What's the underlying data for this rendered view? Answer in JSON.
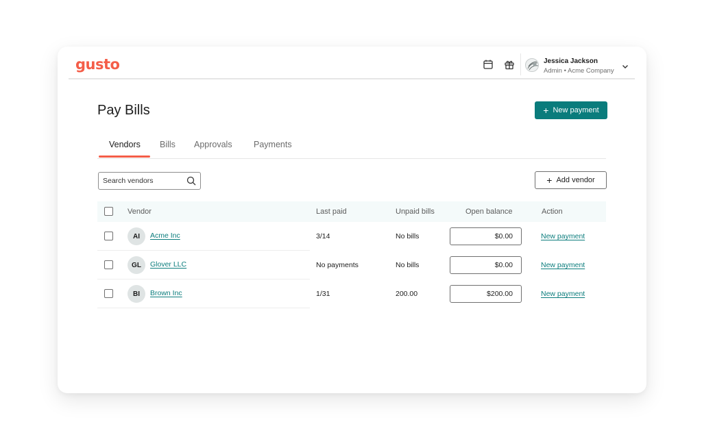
{
  "header": {
    "logo": "gusto",
    "user_name": "Jessica Jackson",
    "user_role": "Admin • Acme Company",
    "icons": [
      "calendar-icon",
      "gift-icon",
      "avatar",
      "chevron-down-icon"
    ]
  },
  "page": {
    "title": "Pay Bills",
    "new_payment_label": "New payment"
  },
  "tabs": [
    {
      "label": "Vendors",
      "active": true
    },
    {
      "label": "Bills",
      "active": false
    },
    {
      "label": "Approvals",
      "active": false
    },
    {
      "label": "Payments",
      "active": false
    }
  ],
  "search": {
    "placeholder": "Search vendors",
    "value": ""
  },
  "add_vendor_label": "Add vendor",
  "table": {
    "columns": [
      "Vendor",
      "Last paid",
      "Unpaid bills",
      "Open balance",
      "Action"
    ],
    "rows": [
      {
        "initials": "AI",
        "vendor": "Acme Inc",
        "last_paid": "3/14",
        "unpaid_bills": "No bills",
        "open_balance": "$0.00",
        "action": "New payment"
      },
      {
        "initials": "GL",
        "vendor": "Glover LLC",
        "last_paid": "No payments",
        "unpaid_bills": "No bills",
        "open_balance": "$0.00",
        "action": "New payment"
      },
      {
        "initials": "BI",
        "vendor": "Brown Inc",
        "last_paid": "1/31",
        "unpaid_bills": "200.00",
        "open_balance": "$200.00",
        "action": "New payment"
      }
    ]
  },
  "colors": {
    "brand": "#f45d48",
    "primary": "#0a7c7c"
  }
}
